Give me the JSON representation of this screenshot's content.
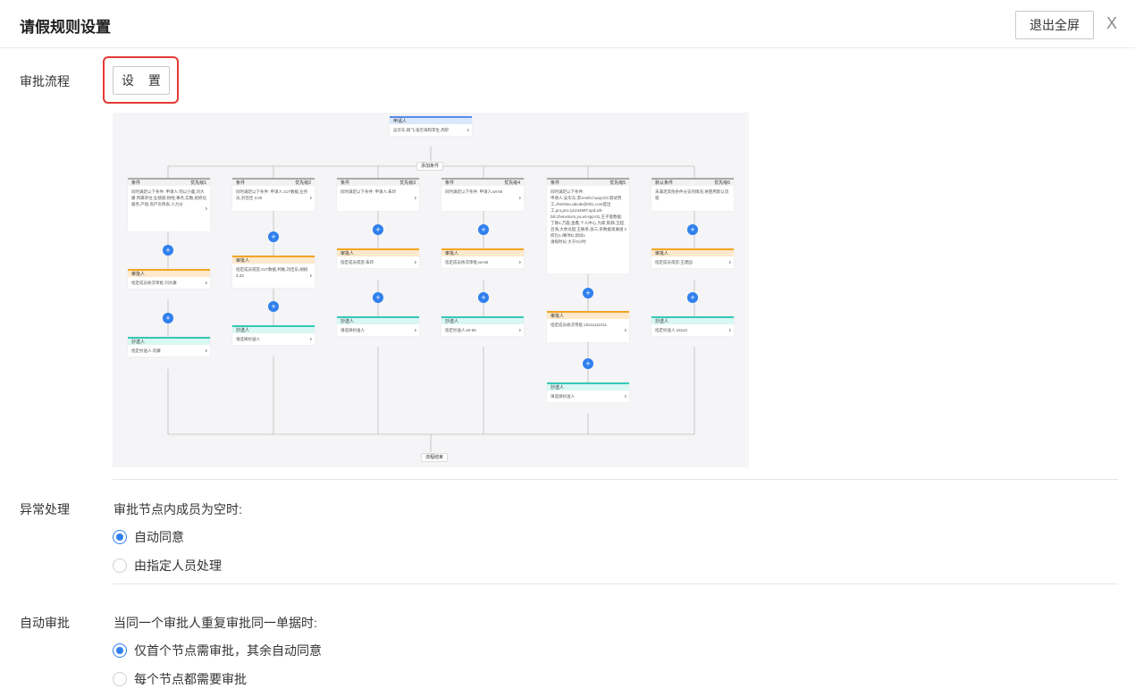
{
  "header": {
    "title": "请假规则设置",
    "exit_fullscreen": "退出全屏",
    "close": "X"
  },
  "approval_flow": {
    "label": "审批流程",
    "set_button": "设 置",
    "diagram": {
      "starter": {
        "head": "申请人",
        "body": "吴华东,顾飞,张京海和李生,周轩"
      },
      "add_condition": "添加条件",
      "end": "流程结束",
      "branches": [
        {
          "cond_head": "条件",
          "priority": "优先级1",
          "cond_body": "同时满足以下条件:\n申请人:何以小童,刘大康\n所属单位:业绩部,财经,事务,实数,组织化服务,产值,资产负债表,人力分",
          "approver_head": "审批人",
          "approver_body": "指定成员依次审批:刘大康",
          "cc_head": "抄送人",
          "cc_body": "指定抄送人:刘康"
        },
        {
          "cond_head": "条件",
          "priority": "优先级2",
          "cond_body": "同时满足以下条件:\n申请人:21T数据,业务员,刘佳佳 3.00",
          "approver_head": "审批人",
          "approver_body": "指定成员或签:21T数据,柯敏,刘佳乐,胡桃3.33",
          "cc_head": "抄送人",
          "cc_body": "请选择抄送人"
        },
        {
          "cond_head": "条件",
          "priority": "优先级3",
          "cond_body": "同时满足以下条件:\n申请人:朱玲",
          "approver_head": "审批人",
          "approver_body": "指定成员或签:朱玲",
          "cc_head": "抄送人",
          "cc_body": "请选择抄送人"
        },
        {
          "cond_head": "条件",
          "priority": "优先级4",
          "cond_body": "同时满足以下条件:\n申请人:wt-56",
          "approver_head": "审批人",
          "approver_body": "指定成员依次审批:wt-56",
          "cc_head": "抄送人",
          "cc_body": "指定抄送人:wt-56"
        },
        {
          "cond_head": "条件",
          "priority": "优先级5",
          "cond_body": "同时满足以下条件:\n申请人:吴华东,李zenith.huayi,DC测试用工,zhenhao.abcde@001.com提出工,pro,pro.cj123456T,spd,wh-bill,zhenxinxm,yu,wt-spp-01,王子俊数据,丁静1,万磊,金鑫,个人中心,为家,陈静,王超,吕海,大余龙超,王敏系,张三,杂数据发展组织包1,l事项D,测试1\n请假时长:大于0小时",
          "approver_head": "审批人",
          "approver_body": "指定成员依次审批:15211111011",
          "cc_head": "抄送人",
          "cc_body": "请选择抄送人"
        },
        {
          "cond_head": "默认条件",
          "priority": "优先级6",
          "cond_body": "未满足其他条件分支的情况,将使用默认流程",
          "approver_head": "审批人",
          "approver_body": "指定成员或签:王建国",
          "cc_head": "抄送人",
          "cc_body": "指定抄送人:15113"
        }
      ]
    }
  },
  "exception_handling": {
    "label": "异常处理",
    "question": "审批节点内成员为空时:",
    "options": [
      {
        "label": "自动同意",
        "selected": true
      },
      {
        "label": "由指定人员处理",
        "selected": false
      }
    ]
  },
  "auto_approval": {
    "label": "自动审批",
    "question": "当同一个审批人重复审批同一单据时:",
    "options": [
      {
        "label": "仅首个节点需审批，其余自动同意",
        "selected": true
      },
      {
        "label": "每个节点都需要审批",
        "selected": false
      }
    ]
  },
  "colors": {
    "accent": "#2f80ed",
    "highlight": "#e53935",
    "approver": "#f5a623",
    "cc": "#36c8b7",
    "starter": "#5a8de8"
  }
}
